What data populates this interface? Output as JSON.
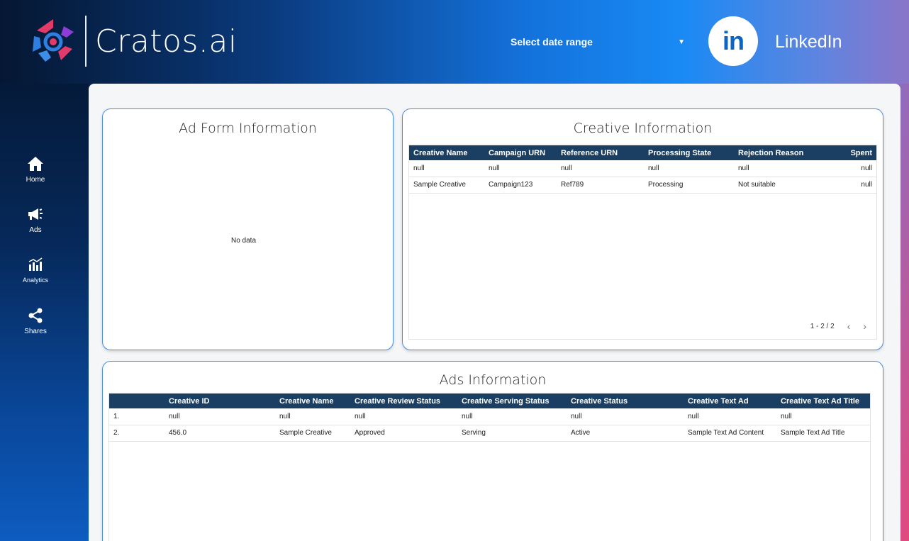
{
  "brand": {
    "name": "Cratos.ai"
  },
  "header": {
    "date_range_label": "Select date range",
    "platform_badge": "in",
    "platform_name": "LinkedIn"
  },
  "sidebar": {
    "items": [
      {
        "label": "Home",
        "icon": "home-icon"
      },
      {
        "label": "Ads",
        "icon": "megaphone-icon"
      },
      {
        "label": "Analytics",
        "icon": "analytics-icon"
      },
      {
        "label": "Shares",
        "icon": "share-icon"
      }
    ]
  },
  "ad_form": {
    "title": "Ad Form Information",
    "empty": "No data"
  },
  "creative": {
    "title": "Creative Information",
    "columns": [
      "Creative Name",
      "Campaign URN",
      "Reference URN",
      "Processing State",
      "Rejection Reason",
      "Spent"
    ],
    "rows": [
      [
        "null",
        "null",
        "null",
        "null",
        "null",
        "null"
      ],
      [
        "Sample Creative",
        "Campaign123",
        "Ref789",
        "Processing",
        "Not suitable",
        "null"
      ]
    ],
    "pagination": "1 - 2 / 2"
  },
  "ads": {
    "title": "Ads Information",
    "columns": [
      "",
      "Creative ID",
      "Creative Name",
      "Creative Review Status",
      "Creative Serving Status",
      "Creative Status",
      "Creative Text Ad",
      "Creative Text Ad Title"
    ],
    "rows": [
      [
        "1.",
        "null",
        "null",
        "null",
        "null",
        "null",
        "null",
        "null"
      ],
      [
        "2.",
        "456.0",
        "Sample Creative",
        "Approved",
        "Serving",
        "Active",
        "Sample Text Ad Content",
        "Sample Text Ad Title"
      ]
    ]
  },
  "colors": {
    "accent": "#1b3f63",
    "card_border": "#4a90e2",
    "linkedin": "#0a66c2"
  }
}
